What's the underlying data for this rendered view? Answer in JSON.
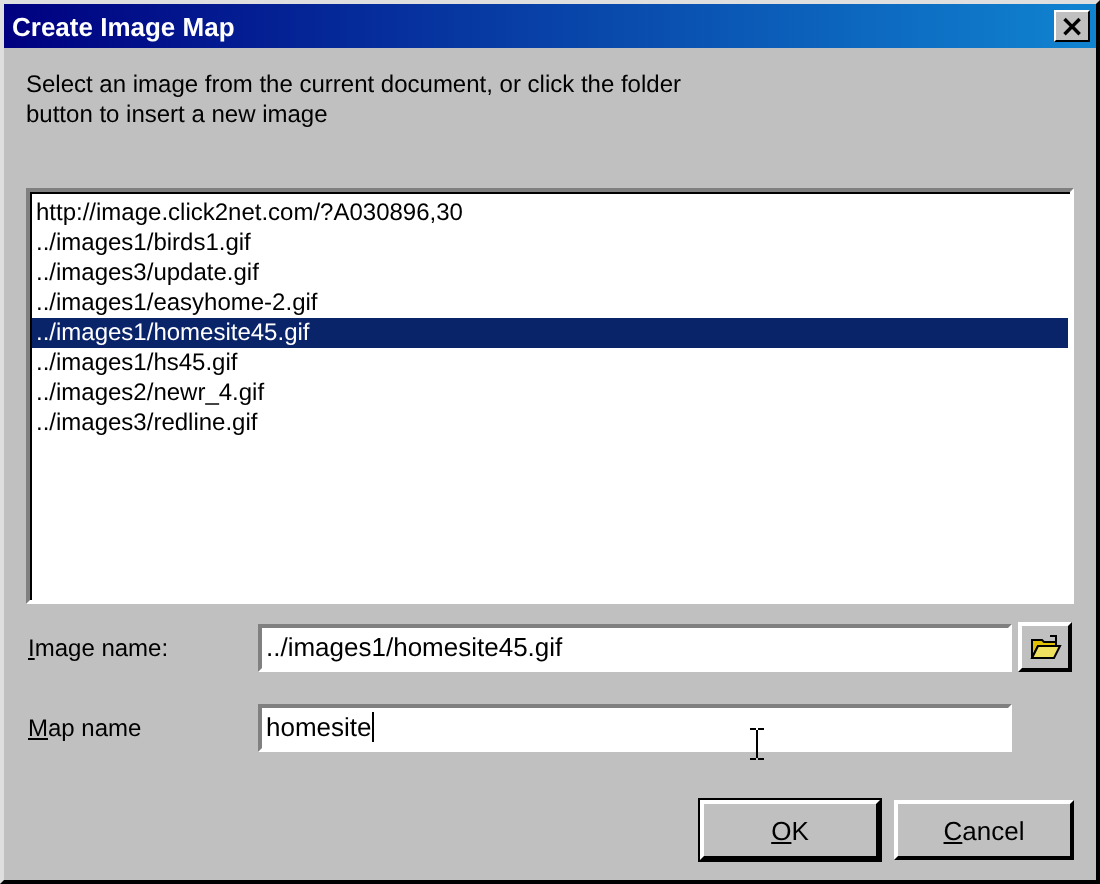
{
  "window": {
    "title": "Create Image Map",
    "close": "×"
  },
  "instructions": "Select an image from the current document, or click the folder\nbutton to insert a new image",
  "image_list": [
    {
      "label": "http://image.click2net.com/?A030896,30",
      "selected": false
    },
    {
      "label": "../images1/birds1.gif",
      "selected": false
    },
    {
      "label": "../images3/update.gif",
      "selected": false
    },
    {
      "label": "../images1/easyhome-2.gif",
      "selected": false
    },
    {
      "label": "../images1/homesite45.gif",
      "selected": true
    },
    {
      "label": "../images1/hs45.gif",
      "selected": false
    },
    {
      "label": "../images2/newr_4.gif",
      "selected": false
    },
    {
      "label": "../images3/redline.gif",
      "selected": false
    }
  ],
  "fields": [
    {
      "label": "Image name:",
      "value": "../images1/homesite45.gif",
      "browse": true,
      "focused": false
    },
    {
      "label": "Map name",
      "value": "homesite",
      "browse": false,
      "focused": true
    }
  ],
  "buttons": [
    {
      "label": "OK",
      "default": true
    },
    {
      "label": "Cancel",
      "default": false
    }
  ]
}
